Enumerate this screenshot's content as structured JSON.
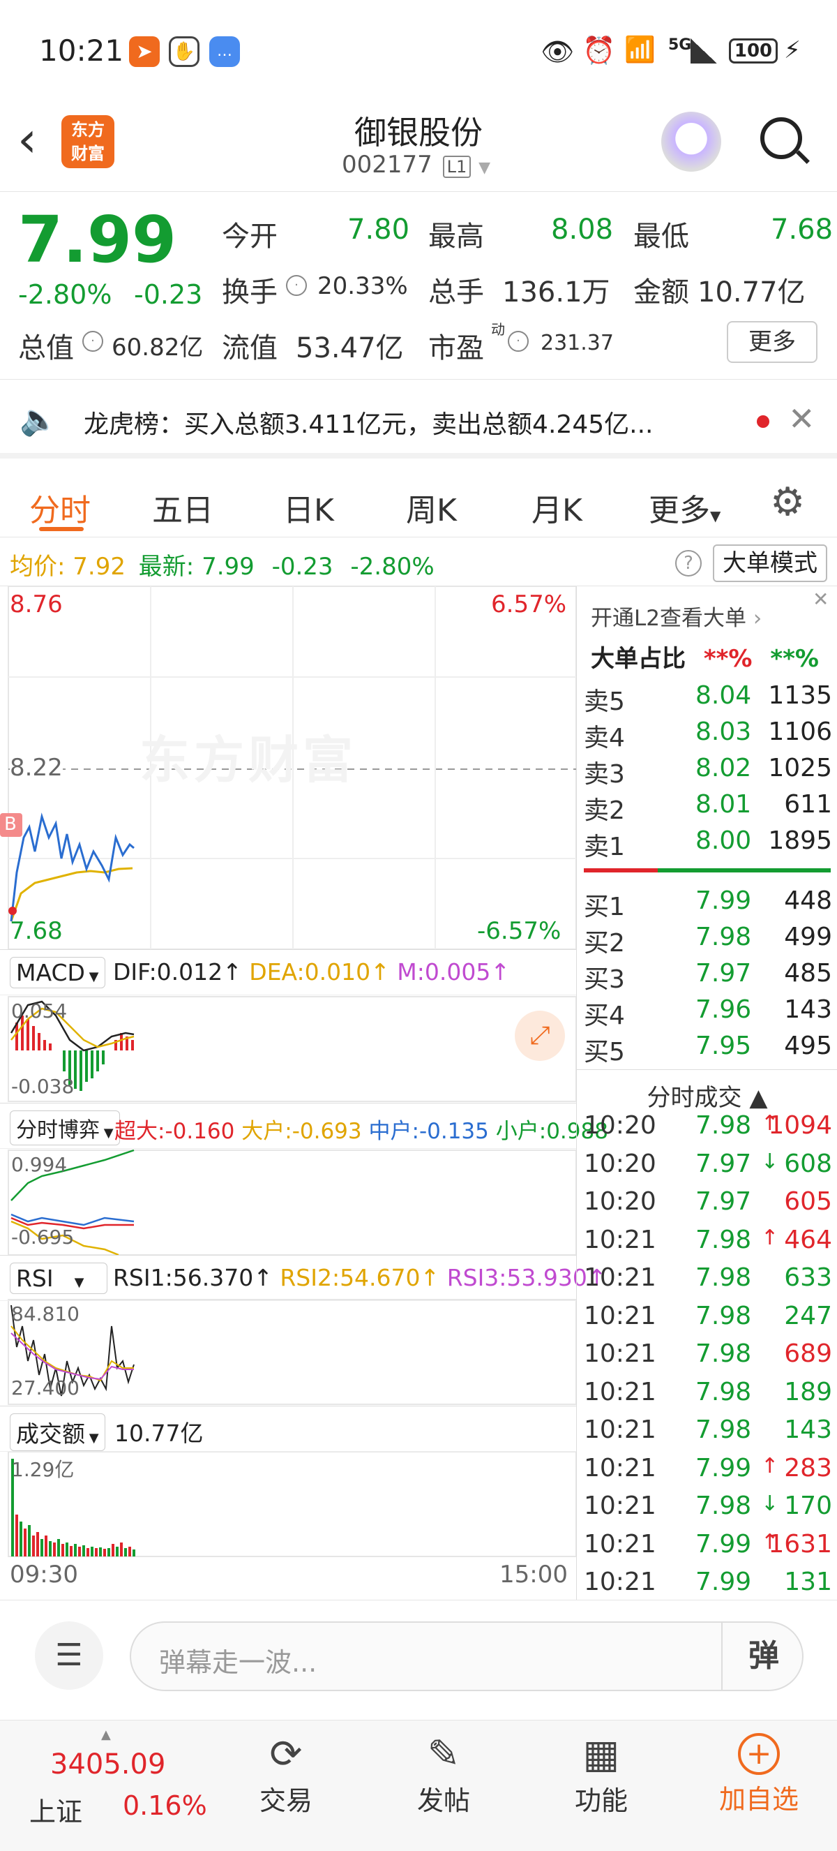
{
  "status": {
    "time": "10:21",
    "battery": "100",
    "network": "5G"
  },
  "nav": {
    "title": "御银股份",
    "code": "002177",
    "level": "L1",
    "logo": "东方\n财富"
  },
  "quote": {
    "price": "7.99",
    "pct": "-2.80%",
    "chg": "-0.23",
    "open_label": "今开",
    "open": "7.80",
    "high_label": "最高",
    "high": "8.08",
    "low_label": "最低",
    "low": "7.68",
    "turnover_label": "换手",
    "turnover": "20.33%",
    "volume_label": "总手",
    "volume": "136.1万",
    "amount_label": "金额",
    "amount": "10.77亿",
    "mcap_label": "总值",
    "mcap": "60.82亿",
    "float_label": "流值",
    "float": "53.47亿",
    "pe_label": "市盈",
    "pe_sup": "动",
    "pe": "231.37",
    "more": "更多"
  },
  "notice": {
    "text": "龙虎榜：买入总额3.411亿元，卖出总额4.245亿..."
  },
  "tabs": [
    "分时",
    "五日",
    "日K",
    "周K",
    "月K",
    "更多"
  ],
  "info": {
    "avg_label": "均价:",
    "avg": "7.92",
    "latest_label": "最新:",
    "latest": "7.99",
    "chg": "-0.23",
    "pct": "-2.80%",
    "mode": "大单模式"
  },
  "chart": {
    "ymax": "8.76",
    "ymid": "8.22",
    "ymin": "7.68",
    "pmax": "6.57%",
    "pmin": "-6.57%",
    "watermark": "东方财富",
    "start": "09:30",
    "end": "15:00",
    "b_marker": "B"
  },
  "macd": {
    "name": "MACD",
    "dif": "DIF:0.012",
    "dea": "DEA:0.010",
    "m": "M:0.005",
    "top": "0.054",
    "bottom": "-0.038"
  },
  "flow": {
    "name": "分时博弈",
    "super": "超大:-0.160",
    "big": "大户:-0.693",
    "mid": "中户:-0.135",
    "small": "小户:0.988",
    "top": "0.994",
    "bottom": "-0.695"
  },
  "rsi": {
    "name": "RSI",
    "r1": "RSI1:56.370",
    "r2": "RSI2:54.670",
    "r3": "RSI3:53.930",
    "top": "84.810",
    "bottom": "27.400"
  },
  "vol": {
    "name": "成交额",
    "value": "10.77亿",
    "top": "1.29亿"
  },
  "orderbook": {
    "l2": "开通L2查看大单",
    "ratio_label": "大单占比",
    "r1": "**%",
    "r2": "**%",
    "asks": [
      {
        "l": "卖5",
        "p": "8.04",
        "v": "1135"
      },
      {
        "l": "卖4",
        "p": "8.03",
        "v": "1106"
      },
      {
        "l": "卖3",
        "p": "8.02",
        "v": "1025"
      },
      {
        "l": "卖2",
        "p": "8.01",
        "v": "611"
      },
      {
        "l": "卖1",
        "p": "8.00",
        "v": "1895"
      }
    ],
    "bids": [
      {
        "l": "买1",
        "p": "7.99",
        "v": "448"
      },
      {
        "l": "买2",
        "p": "7.98",
        "v": "499"
      },
      {
        "l": "买3",
        "p": "7.97",
        "v": "485"
      },
      {
        "l": "买4",
        "p": "7.96",
        "v": "143"
      },
      {
        "l": "买5",
        "p": "7.95",
        "v": "495"
      }
    ],
    "trades_title": "分时成交",
    "trades": [
      {
        "t": "10:20",
        "p": "7.98",
        "a": "↑",
        "v": "1094",
        "c": "red"
      },
      {
        "t": "10:20",
        "p": "7.97",
        "a": "↓",
        "v": "608",
        "c": "green"
      },
      {
        "t": "10:20",
        "p": "7.97",
        "a": "",
        "v": "605",
        "c": "red"
      },
      {
        "t": "10:21",
        "p": "7.98",
        "a": "↑",
        "v": "464",
        "c": "red"
      },
      {
        "t": "10:21",
        "p": "7.98",
        "a": "",
        "v": "633",
        "c": "green"
      },
      {
        "t": "10:21",
        "p": "7.98",
        "a": "",
        "v": "247",
        "c": "green"
      },
      {
        "t": "10:21",
        "p": "7.98",
        "a": "",
        "v": "689",
        "c": "red"
      },
      {
        "t": "10:21",
        "p": "7.98",
        "a": "",
        "v": "189",
        "c": "green"
      },
      {
        "t": "10:21",
        "p": "7.98",
        "a": "",
        "v": "143",
        "c": "green"
      },
      {
        "t": "10:21",
        "p": "7.99",
        "a": "↑",
        "v": "283",
        "c": "red"
      },
      {
        "t": "10:21",
        "p": "7.98",
        "a": "↓",
        "v": "170",
        "c": "green"
      },
      {
        "t": "10:21",
        "p": "7.99",
        "a": "↑",
        "v": "1631",
        "c": "red"
      },
      {
        "t": "10:21",
        "p": "7.99",
        "a": "",
        "v": "131",
        "c": "green"
      }
    ]
  },
  "comment": {
    "placeholder": "弹幕走一波...",
    "danmu": "弹"
  },
  "bottom": {
    "index_value": "3405.09",
    "index_name": "上证",
    "index_pct": "0.16%",
    "trade": "交易",
    "post": "发帖",
    "func": "功能",
    "add": "加自选"
  },
  "colors": {
    "up": "#e0252b",
    "down": "#139c31",
    "accent": "#f06a1e",
    "avg": "#e0a400"
  }
}
